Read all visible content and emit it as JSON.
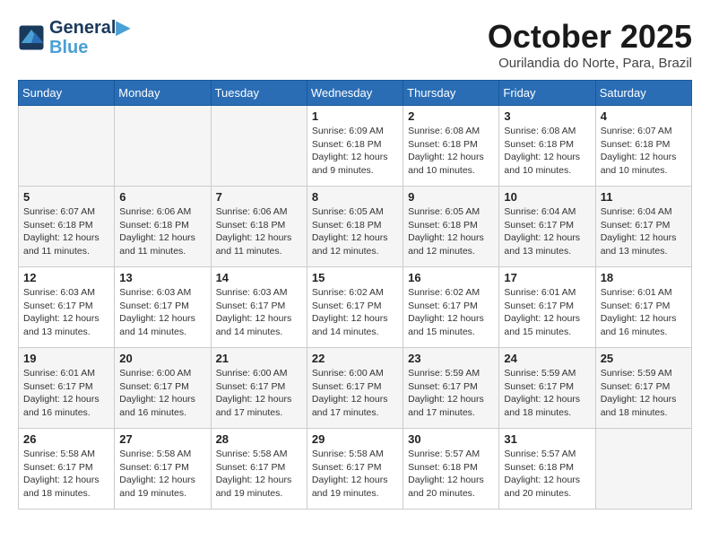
{
  "header": {
    "logo_line1": "General",
    "logo_line2": "Blue",
    "month_title": "October 2025",
    "location": "Ourilandia do Norte, Para, Brazil"
  },
  "weekdays": [
    "Sunday",
    "Monday",
    "Tuesday",
    "Wednesday",
    "Thursday",
    "Friday",
    "Saturday"
  ],
  "weeks": [
    [
      {
        "day": "",
        "info": ""
      },
      {
        "day": "",
        "info": ""
      },
      {
        "day": "",
        "info": ""
      },
      {
        "day": "1",
        "info": "Sunrise: 6:09 AM\nSunset: 6:18 PM\nDaylight: 12 hours\nand 9 minutes."
      },
      {
        "day": "2",
        "info": "Sunrise: 6:08 AM\nSunset: 6:18 PM\nDaylight: 12 hours\nand 10 minutes."
      },
      {
        "day": "3",
        "info": "Sunrise: 6:08 AM\nSunset: 6:18 PM\nDaylight: 12 hours\nand 10 minutes."
      },
      {
        "day": "4",
        "info": "Sunrise: 6:07 AM\nSunset: 6:18 PM\nDaylight: 12 hours\nand 10 minutes."
      }
    ],
    [
      {
        "day": "5",
        "info": "Sunrise: 6:07 AM\nSunset: 6:18 PM\nDaylight: 12 hours\nand 11 minutes."
      },
      {
        "day": "6",
        "info": "Sunrise: 6:06 AM\nSunset: 6:18 PM\nDaylight: 12 hours\nand 11 minutes."
      },
      {
        "day": "7",
        "info": "Sunrise: 6:06 AM\nSunset: 6:18 PM\nDaylight: 12 hours\nand 11 minutes."
      },
      {
        "day": "8",
        "info": "Sunrise: 6:05 AM\nSunset: 6:18 PM\nDaylight: 12 hours\nand 12 minutes."
      },
      {
        "day": "9",
        "info": "Sunrise: 6:05 AM\nSunset: 6:18 PM\nDaylight: 12 hours\nand 12 minutes."
      },
      {
        "day": "10",
        "info": "Sunrise: 6:04 AM\nSunset: 6:17 PM\nDaylight: 12 hours\nand 13 minutes."
      },
      {
        "day": "11",
        "info": "Sunrise: 6:04 AM\nSunset: 6:17 PM\nDaylight: 12 hours\nand 13 minutes."
      }
    ],
    [
      {
        "day": "12",
        "info": "Sunrise: 6:03 AM\nSunset: 6:17 PM\nDaylight: 12 hours\nand 13 minutes."
      },
      {
        "day": "13",
        "info": "Sunrise: 6:03 AM\nSunset: 6:17 PM\nDaylight: 12 hours\nand 14 minutes."
      },
      {
        "day": "14",
        "info": "Sunrise: 6:03 AM\nSunset: 6:17 PM\nDaylight: 12 hours\nand 14 minutes."
      },
      {
        "day": "15",
        "info": "Sunrise: 6:02 AM\nSunset: 6:17 PM\nDaylight: 12 hours\nand 14 minutes."
      },
      {
        "day": "16",
        "info": "Sunrise: 6:02 AM\nSunset: 6:17 PM\nDaylight: 12 hours\nand 15 minutes."
      },
      {
        "day": "17",
        "info": "Sunrise: 6:01 AM\nSunset: 6:17 PM\nDaylight: 12 hours\nand 15 minutes."
      },
      {
        "day": "18",
        "info": "Sunrise: 6:01 AM\nSunset: 6:17 PM\nDaylight: 12 hours\nand 16 minutes."
      }
    ],
    [
      {
        "day": "19",
        "info": "Sunrise: 6:01 AM\nSunset: 6:17 PM\nDaylight: 12 hours\nand 16 minutes."
      },
      {
        "day": "20",
        "info": "Sunrise: 6:00 AM\nSunset: 6:17 PM\nDaylight: 12 hours\nand 16 minutes."
      },
      {
        "day": "21",
        "info": "Sunrise: 6:00 AM\nSunset: 6:17 PM\nDaylight: 12 hours\nand 17 minutes."
      },
      {
        "day": "22",
        "info": "Sunrise: 6:00 AM\nSunset: 6:17 PM\nDaylight: 12 hours\nand 17 minutes."
      },
      {
        "day": "23",
        "info": "Sunrise: 5:59 AM\nSunset: 6:17 PM\nDaylight: 12 hours\nand 17 minutes."
      },
      {
        "day": "24",
        "info": "Sunrise: 5:59 AM\nSunset: 6:17 PM\nDaylight: 12 hours\nand 18 minutes."
      },
      {
        "day": "25",
        "info": "Sunrise: 5:59 AM\nSunset: 6:17 PM\nDaylight: 12 hours\nand 18 minutes."
      }
    ],
    [
      {
        "day": "26",
        "info": "Sunrise: 5:58 AM\nSunset: 6:17 PM\nDaylight: 12 hours\nand 18 minutes."
      },
      {
        "day": "27",
        "info": "Sunrise: 5:58 AM\nSunset: 6:17 PM\nDaylight: 12 hours\nand 19 minutes."
      },
      {
        "day": "28",
        "info": "Sunrise: 5:58 AM\nSunset: 6:17 PM\nDaylight: 12 hours\nand 19 minutes."
      },
      {
        "day": "29",
        "info": "Sunrise: 5:58 AM\nSunset: 6:17 PM\nDaylight: 12 hours\nand 19 minutes."
      },
      {
        "day": "30",
        "info": "Sunrise: 5:57 AM\nSunset: 6:18 PM\nDaylight: 12 hours\nand 20 minutes."
      },
      {
        "day": "31",
        "info": "Sunrise: 5:57 AM\nSunset: 6:18 PM\nDaylight: 12 hours\nand 20 minutes."
      },
      {
        "day": "",
        "info": ""
      }
    ]
  ]
}
